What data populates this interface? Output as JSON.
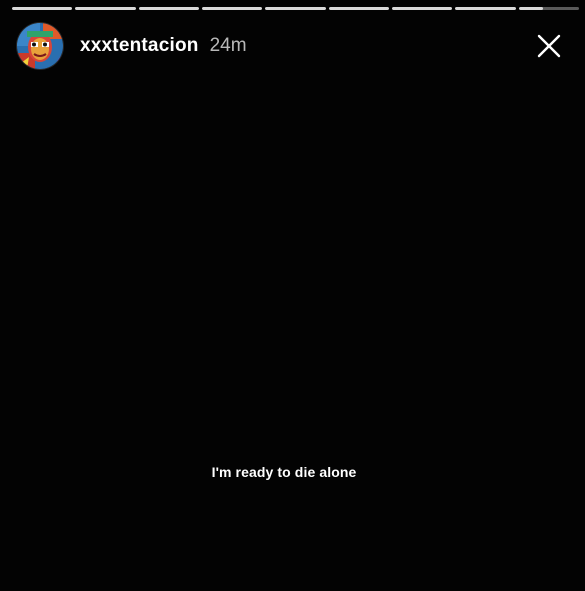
{
  "story": {
    "segment_count": 9,
    "completed_segments": 8,
    "current_segment_progress": 0.4,
    "progress_color": "#d9d9d9",
    "track_color": "rgba(255,255,255,0.35)"
  },
  "header": {
    "avatar_icon": "profile-avatar",
    "username": "xxxtentacion",
    "timestamp": "24m",
    "close_icon": "close-icon"
  },
  "content": {
    "caption": "I'm ready to die alone",
    "background_color": "#030303"
  }
}
